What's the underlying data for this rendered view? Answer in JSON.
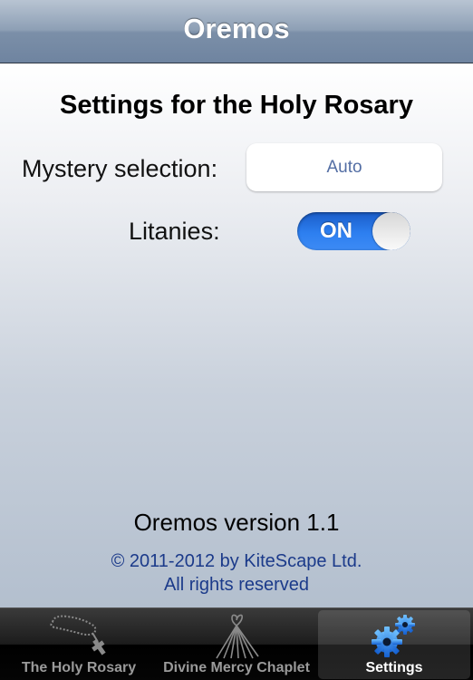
{
  "navbar": {
    "title": "Oremos"
  },
  "settings": {
    "section_title": "Settings for the Holy Rosary",
    "mystery_label": "Mystery selection:",
    "mystery_value": "Auto",
    "litanies_label": "Litanies:",
    "litanies_toggle_text": "ON",
    "litanies_enabled": true
  },
  "footer": {
    "version": "Oremos version 1.1",
    "copyright_line1": "© 2011-2012 by KiteScape Ltd.",
    "copyright_line2": "All rights reserved"
  },
  "tabbar": {
    "tabs": [
      {
        "label": "The Holy Rosary",
        "icon": "rosary-icon",
        "selected": false
      },
      {
        "label": "Divine Mercy Chaplet",
        "icon": "divine-mercy-icon",
        "selected": false
      },
      {
        "label": "Settings",
        "icon": "gears-icon",
        "selected": true
      }
    ]
  },
  "colors": {
    "toggle_on": "#2d7ff0",
    "link_blue": "#1b3a8a",
    "select_value": "#536ea4",
    "settings_icon": "#1e78e6"
  }
}
